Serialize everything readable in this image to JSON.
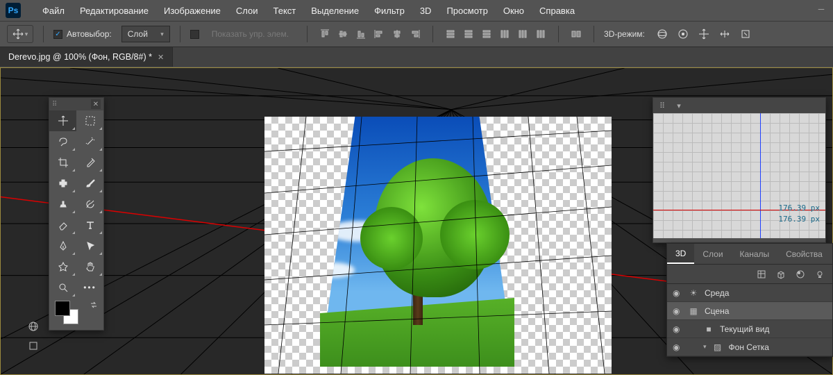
{
  "app": {
    "icon_text": "Ps"
  },
  "menu": {
    "items": [
      "Файл",
      "Редактирование",
      "Изображение",
      "Слои",
      "Текст",
      "Выделение",
      "Фильтр",
      "3D",
      "Просмотр",
      "Окно",
      "Справка"
    ]
  },
  "options": {
    "autoselect_label": "Автовыбор:",
    "autoselect_checked": true,
    "layer_dropdown": "Слой",
    "transform_label": "Показать упр. элем.",
    "mode3d_label": "3D-режим:"
  },
  "document": {
    "tab_title": "Derevo.jpg @ 100% (Фон, RGB/8#) *"
  },
  "tools": {
    "list": [
      {
        "name": "move",
        "active": true
      },
      {
        "name": "marquee"
      },
      {
        "name": "lasso"
      },
      {
        "name": "magic-wand"
      },
      {
        "name": "crop"
      },
      {
        "name": "eyedropper"
      },
      {
        "name": "spot-heal"
      },
      {
        "name": "brush"
      },
      {
        "name": "clone-stamp"
      },
      {
        "name": "history-brush"
      },
      {
        "name": "eraser"
      },
      {
        "name": "type"
      },
      {
        "name": "pen"
      },
      {
        "name": "path-select"
      },
      {
        "name": "shape"
      },
      {
        "name": "hand"
      },
      {
        "name": "zoom"
      },
      {
        "name": "more"
      }
    ],
    "foreground": "#000000",
    "background": "#ffffff"
  },
  "navigator": {
    "coord1": "176.39 px",
    "coord2": "176.39 px"
  },
  "panel3d": {
    "tabs": [
      "3D",
      "Слои",
      "Каналы",
      "Свойства"
    ],
    "active_tab": 0,
    "layers": [
      {
        "label": "Среда",
        "icon": "sun",
        "indent": 0
      },
      {
        "label": "Сцена",
        "icon": "scene",
        "indent": 0,
        "active": true
      },
      {
        "label": "Текущий вид",
        "icon": "camera",
        "indent": 1
      },
      {
        "label": "Фон Сетка",
        "icon": "mesh",
        "indent": 1
      }
    ]
  },
  "colors": {
    "accent": "#31a8ff",
    "bg_dark": "#282828",
    "panel": "#535353"
  }
}
